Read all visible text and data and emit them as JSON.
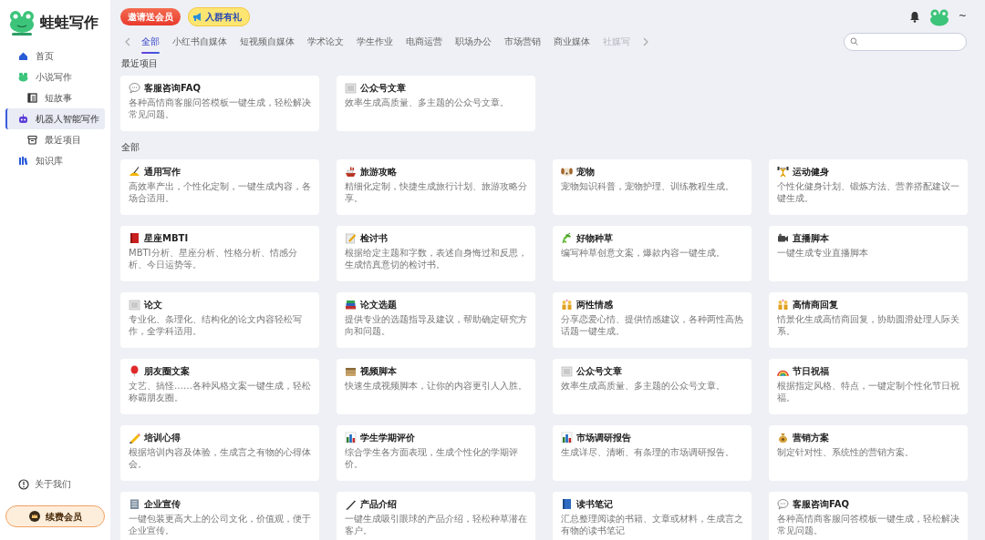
{
  "app": {
    "name": "蛙蛙写作"
  },
  "sidebar": {
    "items": [
      {
        "label": "首页",
        "selected": false
      },
      {
        "label": "小说写作",
        "selected": false,
        "children": [
          {
            "label": "短故事",
            "selected": false
          }
        ]
      },
      {
        "label": "机器人智能写作",
        "selected": true,
        "children": [
          {
            "label": "最近项目",
            "selected": false
          }
        ]
      },
      {
        "label": "知识库",
        "selected": false
      }
    ],
    "about": "关于我们",
    "renew_button": "续费会员"
  },
  "top_bar": {
    "promos": [
      "邀请送会员",
      "入群有礼"
    ],
    "user_suffix": "~"
  },
  "tabs": [
    {
      "label": "全部",
      "selected": true
    },
    {
      "label": "小红书自媒体",
      "selected": false
    },
    {
      "label": "短视频自媒体",
      "selected": false
    },
    {
      "label": "学术论文",
      "selected": false
    },
    {
      "label": "学生作业",
      "selected": false
    },
    {
      "label": "电商运营",
      "selected": false
    },
    {
      "label": "职场办公",
      "selected": false
    },
    {
      "label": "市场营销",
      "selected": false
    },
    {
      "label": "商业媒体",
      "selected": false
    },
    {
      "label": "社媒写",
      "selected": false
    }
  ],
  "recent": {
    "heading": "最近项目",
    "items": [
      {
        "title": "客服咨询FAQ",
        "desc": "各种高情商客服问答模板一键生成，轻松解决常见问题。"
      },
      {
        "title": "公众号文章",
        "desc": "效率生成高质量、多主题的公众号文章。"
      }
    ]
  },
  "all": {
    "heading": "全部",
    "items": [
      {
        "title": "通用写作",
        "desc": "高效率产出，个性化定制，一键生成内容，各场合适用。"
      },
      {
        "title": "旅游攻略",
        "desc": "精细化定制，快捷生成旅行计划、旅游攻略分享。"
      },
      {
        "title": "宠物",
        "desc": "宠物知识科普，宠物护理、训练教程生成。"
      },
      {
        "title": "运动健身",
        "desc": "个性化健身计划、锻炼方法、营养搭配建议一键生成。"
      },
      {
        "title": "星座MBTI",
        "desc": "MBTI分析、星座分析、性格分析、情感分析、今日运势等。"
      },
      {
        "title": "检讨书",
        "desc": "根据给定主题和字数，表述自身悔过和反思，生成情真意切的检讨书。"
      },
      {
        "title": "好物种草",
        "desc": "编写种草创意文案，爆款内容一键生成。"
      },
      {
        "title": "直播脚本",
        "desc": "一键生成专业直播脚本"
      },
      {
        "title": "论文",
        "desc": "专业化、条理化、结构化的论文内容轻松写作，全学科适用。"
      },
      {
        "title": "论文选题",
        "desc": "提供专业的选题指导及建议，帮助确定研究方向和问题。"
      },
      {
        "title": "两性情感",
        "desc": "分享恋爱心情、提供情感建议，各种两性高热话题一键生成。"
      },
      {
        "title": "高情商回复",
        "desc": "情景化生成高情商回复，协助圆滑处理人际关系。"
      },
      {
        "title": "朋友圈文案",
        "desc": "文艺、搞怪……各种风格文案一键生成，轻松称霸朋友圈。"
      },
      {
        "title": "视频脚本",
        "desc": "快速生成视频脚本，让你的内容更引人入胜。"
      },
      {
        "title": "公众号文章",
        "desc": "效率生成高质量、多主题的公众号文章。"
      },
      {
        "title": "节日祝福",
        "desc": "根据指定风格、特点，一键定制个性化节日祝福。"
      },
      {
        "title": "培训心得",
        "desc": "根据培训内容及体验，生成言之有物的心得体会。"
      },
      {
        "title": "学生学期评价",
        "desc": "综合学生各方面表现，生成个性化的学期评价。"
      },
      {
        "title": "市场调研报告",
        "desc": "生成详尽、清晰、有条理的市场调研报告。"
      },
      {
        "title": "营销方案",
        "desc": "制定针对性、系统性的营销方案。"
      },
      {
        "title": "企业宣传",
        "desc": "一键包装更高大上的公司文化，价值观，便于企业宣传。"
      },
      {
        "title": "产品介绍",
        "desc": "一键生成吸引眼球的产品介绍，轻松种草潜在客户。"
      },
      {
        "title": "读书笔记",
        "desc": "汇总整理阅读的书籍、文章或材料，生成言之有物的读书笔记"
      },
      {
        "title": "客服咨询FAQ",
        "desc": "各种高情商客服问答模板一键生成，轻松解决常见问题。"
      }
    ]
  }
}
